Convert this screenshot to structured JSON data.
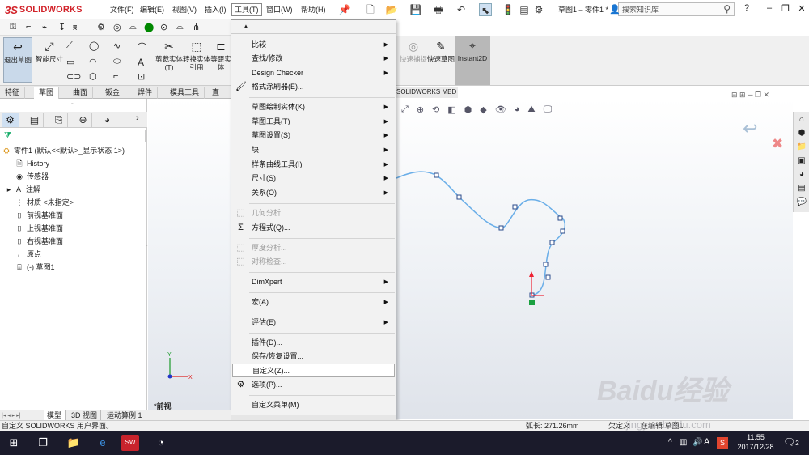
{
  "app": {
    "brand_ds": "3S",
    "brand": "SOLIDWORKS",
    "doc_title": "草图1 – 零件1 *"
  },
  "menubar": {
    "items": [
      "文件(F)",
      "编辑(E)",
      "视图(V)",
      "插入(I)",
      "工具(T)",
      "窗口(W)",
      "帮助(H)"
    ],
    "active": "工具(T)"
  },
  "search": {
    "placeholder": "搜索知识库"
  },
  "commands": {
    "exit_sketch": "退出草图",
    "smart_dim": "智能尺寸",
    "trim": "剪裁实体(T)",
    "convert": "转换实体引用",
    "offset": "等距实体",
    "quick_snap": "快速捕捉",
    "rapid_sketch": "快速草图",
    "instant2d": "Instant2D"
  },
  "tabs": [
    "特征",
    "草图",
    "曲面",
    "钣金",
    "焊件",
    "模具工具",
    "直接编"
  ],
  "tab_selected": "草图",
  "mbd_tab": "SOLIDWORKS MBD",
  "feature_tree": {
    "root": "零件1 (默认<<默认>_显示状态 1>)",
    "items": [
      "History",
      "传感器",
      "注解",
      "材质 <未指定>",
      "前视基准面",
      "上视基准面",
      "右视基准面",
      "原点",
      "(-) 草图1"
    ]
  },
  "tools_menu": {
    "items": [
      {
        "label": "比较",
        "submenu": true,
        "disabled": false
      },
      {
        "label": "查找/修改",
        "submenu": true,
        "disabled": false
      },
      {
        "label": "Design Checker",
        "submenu": true,
        "disabled": false
      },
      {
        "label": "格式涂刷器(E)...",
        "submenu": false,
        "disabled": false,
        "icon": "brush"
      },
      {
        "label": "草图绘制实体(K)",
        "submenu": true,
        "disabled": false
      },
      {
        "label": "草图工具(T)",
        "submenu": true,
        "disabled": false
      },
      {
        "label": "草图设置(S)",
        "submenu": true,
        "disabled": false
      },
      {
        "label": "块",
        "submenu": true,
        "disabled": false
      },
      {
        "label": "样条曲线工具(I)",
        "submenu": true,
        "disabled": false
      },
      {
        "label": "尺寸(S)",
        "submenu": true,
        "disabled": false
      },
      {
        "label": "关系(O)",
        "submenu": true,
        "disabled": false
      },
      {
        "label": "几何分析...",
        "submenu": false,
        "disabled": true
      },
      {
        "label": "方程式(Q)...",
        "submenu": false,
        "disabled": false,
        "icon": "sigma"
      },
      {
        "label": "厚度分析...",
        "submenu": false,
        "disabled": true
      },
      {
        "label": "对称检查...",
        "submenu": false,
        "disabled": true
      },
      {
        "label": "DimXpert",
        "submenu": true,
        "disabled": false
      },
      {
        "label": "宏(A)",
        "submenu": true,
        "disabled": false
      },
      {
        "label": "评估(E)",
        "submenu": true,
        "disabled": false
      },
      {
        "label": "插件(D)...",
        "submenu": false,
        "disabled": false
      },
      {
        "label": "保存/恢复设置...",
        "submenu": false,
        "disabled": false
      },
      {
        "label": "自定义(Z)...",
        "submenu": false,
        "disabled": false,
        "highlight": true
      },
      {
        "label": "选项(P)...",
        "submenu": false,
        "disabled": false,
        "icon": "gear"
      },
      {
        "label": "自定义菜单(M)",
        "submenu": false,
        "disabled": false
      }
    ]
  },
  "view_label": "*前视",
  "bottom_tabs": [
    "模型",
    "3D 视图",
    "运动算例 1"
  ],
  "status": {
    "left": "自定义 SOLIDWORKS 用户界面。",
    "arc_length": "弧长: 271.26mm",
    "defined": "欠定义",
    "editing": "在编辑 草图1"
  },
  "clock": {
    "time": "11:55",
    "date": "2017/12/28"
  },
  "taskbar_notify": "2",
  "watermark": {
    "text": "Baidu经验",
    "url": "jingyan.baidu.com"
  },
  "colors": {
    "accent": "#d2232a",
    "spline": "#6aaee8",
    "menu_bg": "#f2f2f2"
  }
}
